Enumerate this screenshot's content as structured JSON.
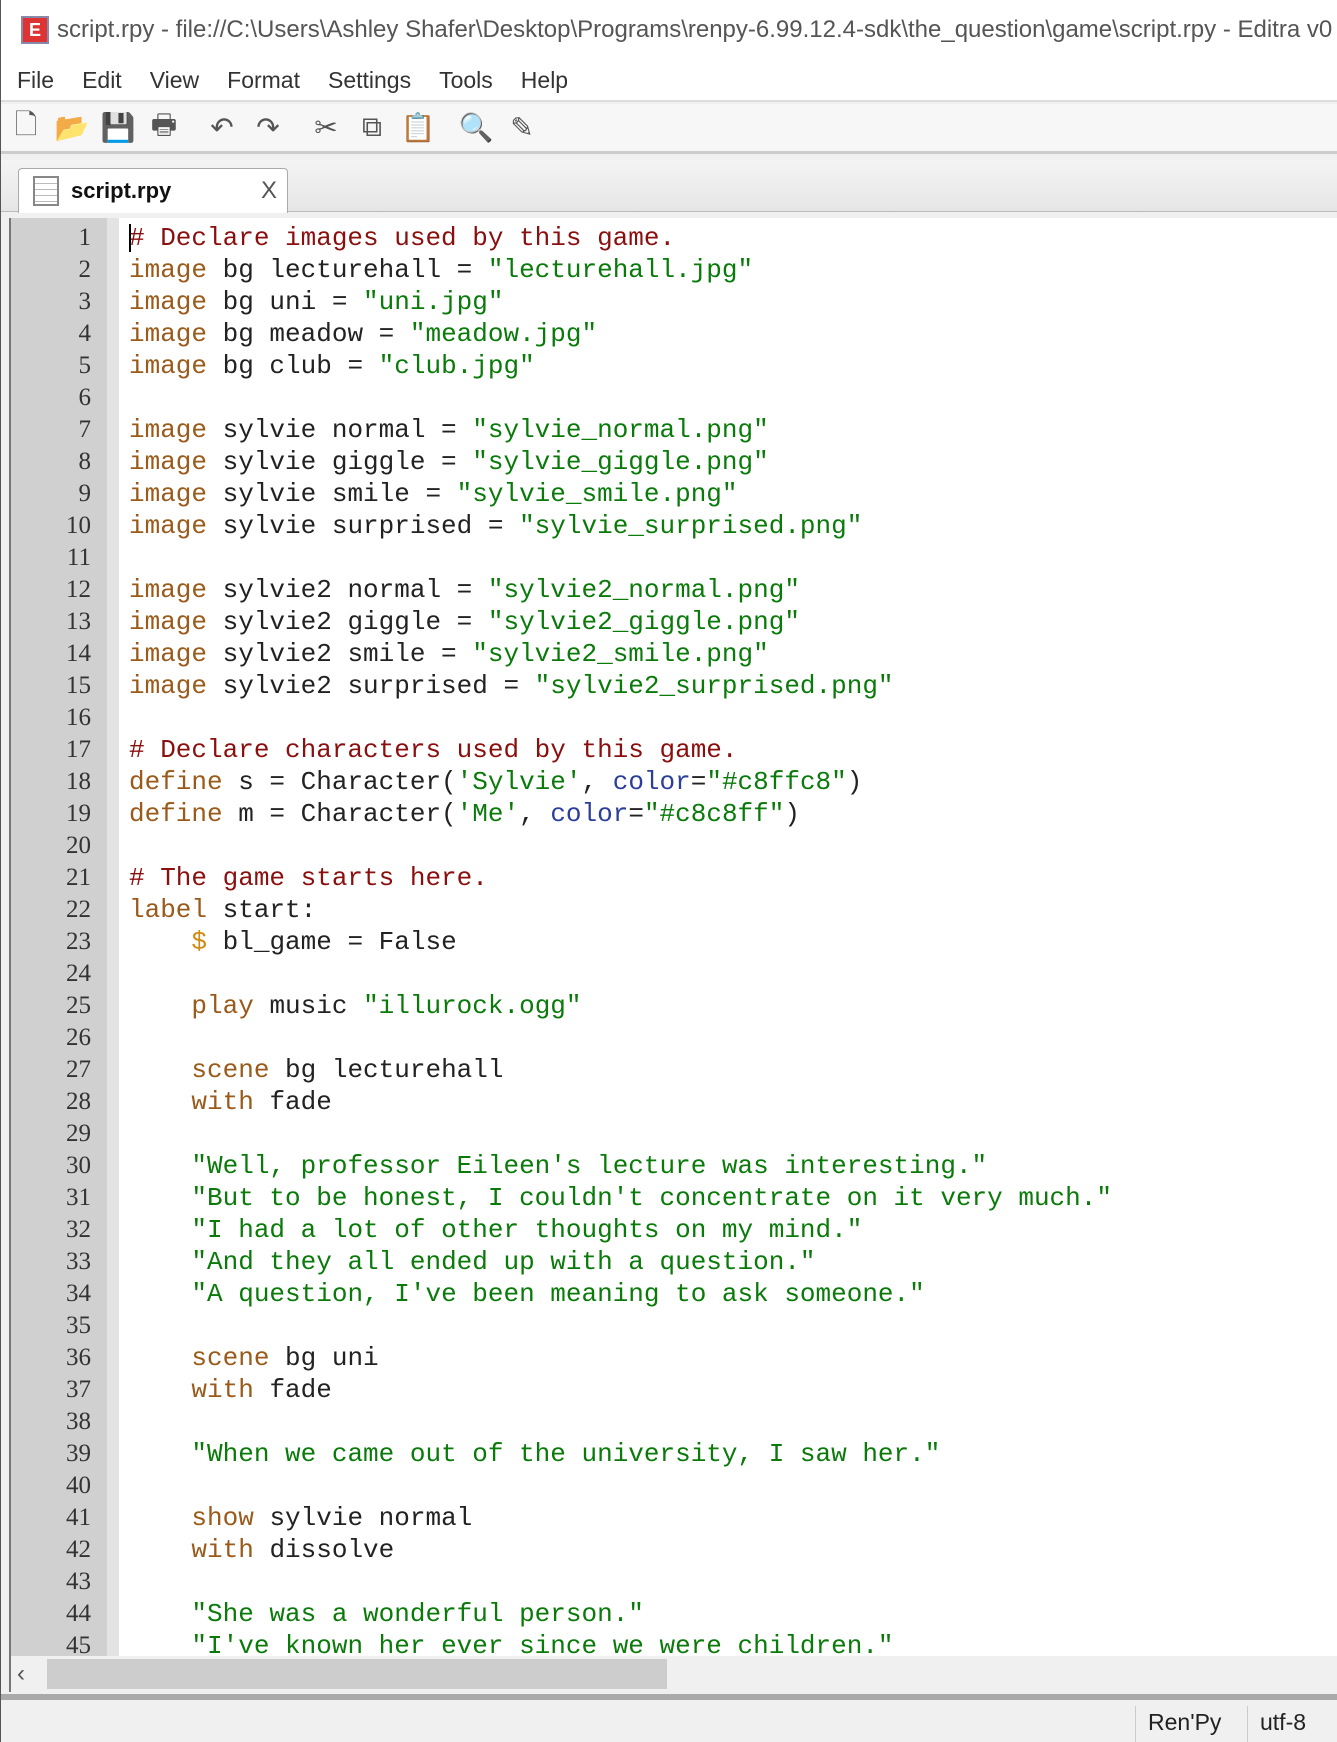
{
  "window": {
    "title": "script.rpy - file://C:\\Users\\Ashley Shafer\\Desktop\\Programs\\renpy-6.99.12.4-sdk\\the_question\\game\\script.rpy - Editra v0"
  },
  "menu": [
    "File",
    "Edit",
    "View",
    "Format",
    "Settings",
    "Tools",
    "Help"
  ],
  "toolbar": [
    {
      "icon": "new-file-icon",
      "glyph": "🗋"
    },
    {
      "icon": "open-folder-icon",
      "glyph": "📂"
    },
    {
      "icon": "save-icon",
      "glyph": "💾"
    },
    {
      "icon": "print-icon",
      "glyph": "🖶"
    },
    {
      "sep": true
    },
    {
      "icon": "undo-icon",
      "glyph": "↶"
    },
    {
      "icon": "redo-icon",
      "glyph": "↷"
    },
    {
      "sep": true
    },
    {
      "icon": "cut-icon",
      "glyph": "✂"
    },
    {
      "icon": "copy-icon",
      "glyph": "⧉"
    },
    {
      "icon": "paste-icon",
      "glyph": "📋"
    },
    {
      "sep": true
    },
    {
      "icon": "find-icon",
      "glyph": "🔍"
    },
    {
      "icon": "find-replace-icon",
      "glyph": "✎"
    }
  ],
  "tab": {
    "label": "script.rpy",
    "close": "X"
  },
  "code": [
    [
      [
        "# Declare images used by this game.",
        "c"
      ]
    ],
    [
      [
        "image",
        "k"
      ],
      [
        " bg lecturehall = ",
        "t"
      ],
      [
        "\"lecturehall.jpg\"",
        "s"
      ]
    ],
    [
      [
        "image",
        "k"
      ],
      [
        " bg uni = ",
        "t"
      ],
      [
        "\"uni.jpg\"",
        "s"
      ]
    ],
    [
      [
        "image",
        "k"
      ],
      [
        " bg meadow = ",
        "t"
      ],
      [
        "\"meadow.jpg\"",
        "s"
      ]
    ],
    [
      [
        "image",
        "k"
      ],
      [
        " bg club = ",
        "t"
      ],
      [
        "\"club.jpg\"",
        "s"
      ]
    ],
    [],
    [
      [
        "image",
        "k"
      ],
      [
        " sylvie normal = ",
        "t"
      ],
      [
        "\"sylvie_normal.png\"",
        "s"
      ]
    ],
    [
      [
        "image",
        "k"
      ],
      [
        " sylvie giggle = ",
        "t"
      ],
      [
        "\"sylvie_giggle.png\"",
        "s"
      ]
    ],
    [
      [
        "image",
        "k"
      ],
      [
        " sylvie smile = ",
        "t"
      ],
      [
        "\"sylvie_smile.png\"",
        "s"
      ]
    ],
    [
      [
        "image",
        "k"
      ],
      [
        " sylvie surprised = ",
        "t"
      ],
      [
        "\"sylvie_surprised.png\"",
        "s"
      ]
    ],
    [],
    [
      [
        "image",
        "k"
      ],
      [
        " sylvie2 normal = ",
        "t"
      ],
      [
        "\"sylvie2_normal.png\"",
        "s"
      ]
    ],
    [
      [
        "image",
        "k"
      ],
      [
        " sylvie2 giggle = ",
        "t"
      ],
      [
        "\"sylvie2_giggle.png\"",
        "s"
      ]
    ],
    [
      [
        "image",
        "k"
      ],
      [
        " sylvie2 smile = ",
        "t"
      ],
      [
        "\"sylvie2_smile.png\"",
        "s"
      ]
    ],
    [
      [
        "image",
        "k"
      ],
      [
        " sylvie2 surprised = ",
        "t"
      ],
      [
        "\"sylvie2_surprised.png\"",
        "s"
      ]
    ],
    [],
    [
      [
        "# Declare characters used by this game.",
        "c"
      ]
    ],
    [
      [
        "define",
        "k"
      ],
      [
        " s = Character(",
        "t"
      ],
      [
        "'Sylvie'",
        "s"
      ],
      [
        ", ",
        "t"
      ],
      [
        "color",
        "b"
      ],
      [
        "=",
        "t"
      ],
      [
        "\"#c8ffc8\"",
        "s"
      ],
      [
        ")",
        "t"
      ]
    ],
    [
      [
        "define",
        "k"
      ],
      [
        " m = Character(",
        "t"
      ],
      [
        "'Me'",
        "s"
      ],
      [
        ", ",
        "t"
      ],
      [
        "color",
        "b"
      ],
      [
        "=",
        "t"
      ],
      [
        "\"#c8c8ff\"",
        "s"
      ],
      [
        ")",
        "t"
      ]
    ],
    [],
    [
      [
        "# The game starts here.",
        "c"
      ]
    ],
    [
      [
        "label",
        "k"
      ],
      [
        " start:",
        "t"
      ]
    ],
    [
      [
        "    ",
        "t"
      ],
      [
        "$",
        "o"
      ],
      [
        " bl_game = False",
        "t"
      ]
    ],
    [],
    [
      [
        "    ",
        "t"
      ],
      [
        "play",
        "k"
      ],
      [
        " music ",
        "t"
      ],
      [
        "\"illurock.ogg\"",
        "s"
      ]
    ],
    [],
    [
      [
        "    ",
        "t"
      ],
      [
        "scene",
        "k"
      ],
      [
        " bg lecturehall",
        "t"
      ]
    ],
    [
      [
        "    ",
        "t"
      ],
      [
        "with",
        "k"
      ],
      [
        " fade",
        "t"
      ]
    ],
    [],
    [
      [
        "    ",
        "t"
      ],
      [
        "\"Well, professor Eileen's lecture was interesting.\"",
        "s"
      ]
    ],
    [
      [
        "    ",
        "t"
      ],
      [
        "\"But to be honest, I couldn't concentrate on it very much.\"",
        "s"
      ]
    ],
    [
      [
        "    ",
        "t"
      ],
      [
        "\"I had a lot of other thoughts on my mind.\"",
        "s"
      ]
    ],
    [
      [
        "    ",
        "t"
      ],
      [
        "\"And they all ended up with a question.\"",
        "s"
      ]
    ],
    [
      [
        "    ",
        "t"
      ],
      [
        "\"A question, I've been meaning to ask someone.\"",
        "s"
      ]
    ],
    [],
    [
      [
        "    ",
        "t"
      ],
      [
        "scene",
        "k"
      ],
      [
        " bg uni",
        "t"
      ]
    ],
    [
      [
        "    ",
        "t"
      ],
      [
        "with",
        "k"
      ],
      [
        " fade",
        "t"
      ]
    ],
    [],
    [
      [
        "    ",
        "t"
      ],
      [
        "\"When we came out of the university, I saw her.\"",
        "s"
      ]
    ],
    [],
    [
      [
        "    ",
        "t"
      ],
      [
        "show",
        "k"
      ],
      [
        " sylvie normal",
        "t"
      ]
    ],
    [
      [
        "    ",
        "t"
      ],
      [
        "with",
        "k"
      ],
      [
        " dissolve",
        "t"
      ]
    ],
    [],
    [
      [
        "    ",
        "t"
      ],
      [
        "\"She was a wonderful person.\"",
        "s"
      ]
    ],
    [
      [
        "    ",
        "t"
      ],
      [
        "\"I've known her ever since we were children.\"",
        "s"
      ]
    ]
  ],
  "line_numbers": [
    "1",
    "2",
    "3",
    "4",
    "5",
    "6",
    "7",
    "8",
    "9",
    "10",
    "11",
    "12",
    "13",
    "14",
    "15",
    "16",
    "17",
    "18",
    "19",
    "20",
    "21",
    "22",
    "23",
    "24",
    "25",
    "26",
    "27",
    "28",
    "29",
    "30",
    "31",
    "32",
    "33",
    "34",
    "35",
    "36",
    "37",
    "38",
    "39",
    "40",
    "41",
    "42",
    "43",
    "44",
    "45"
  ],
  "scrollbar": {
    "left_arrow": "‹"
  },
  "status": {
    "language": "Ren'Py",
    "encoding": "utf-8"
  }
}
